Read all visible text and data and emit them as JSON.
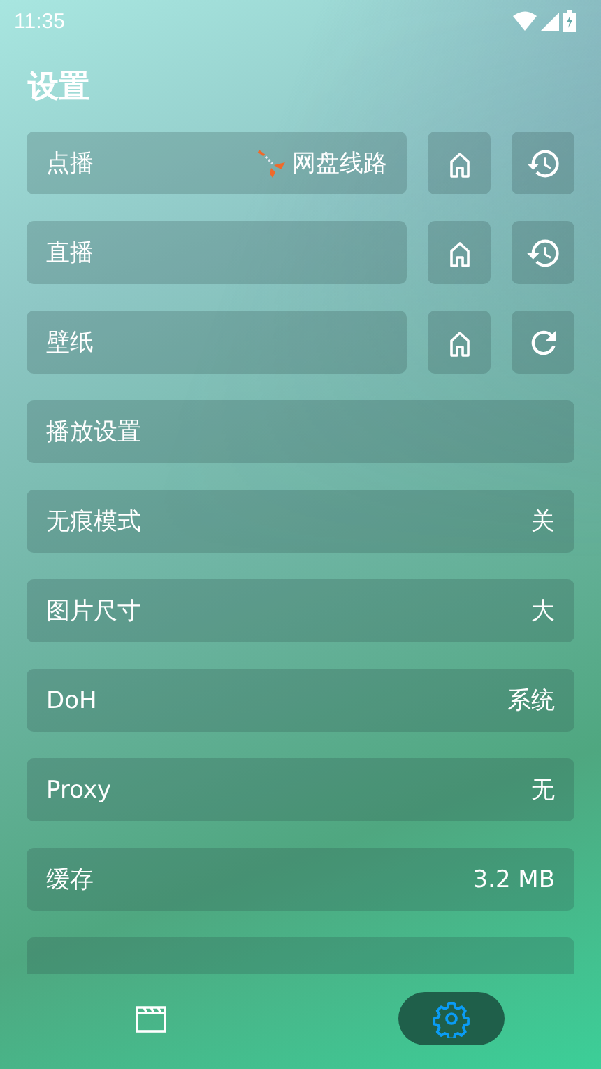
{
  "status_bar": {
    "time": "11:35"
  },
  "title": "设置",
  "source_rows": [
    {
      "label": "点播",
      "value": "网盘线路",
      "value_icon": {
        "kind": "route"
      },
      "actions": [
        {
          "kind": "home"
        },
        {
          "kind": "history"
        }
      ]
    },
    {
      "label": "直播",
      "actions": [
        {
          "kind": "home"
        },
        {
          "kind": "history"
        }
      ]
    },
    {
      "label": "壁纸",
      "actions": [
        {
          "kind": "home"
        },
        {
          "kind": "refresh"
        }
      ]
    }
  ],
  "settings": [
    {
      "kind": "row",
      "label": "播放设置"
    },
    {
      "kind": "row",
      "label": "无痕模式",
      "value": "关"
    },
    {
      "kind": "row",
      "label": "图片尺寸",
      "value": "大"
    },
    {
      "kind": "row",
      "label": "DoH",
      "value": "系统"
    },
    {
      "kind": "row",
      "label": "Proxy",
      "value": "无"
    },
    {
      "kind": "row",
      "label": "缓存",
      "value": "3.2 MB"
    },
    {
      "kind": "cut"
    }
  ],
  "nav": [
    {
      "kind": "clapper",
      "selected": false
    },
    {
      "kind": "gear",
      "selected": true
    }
  ]
}
